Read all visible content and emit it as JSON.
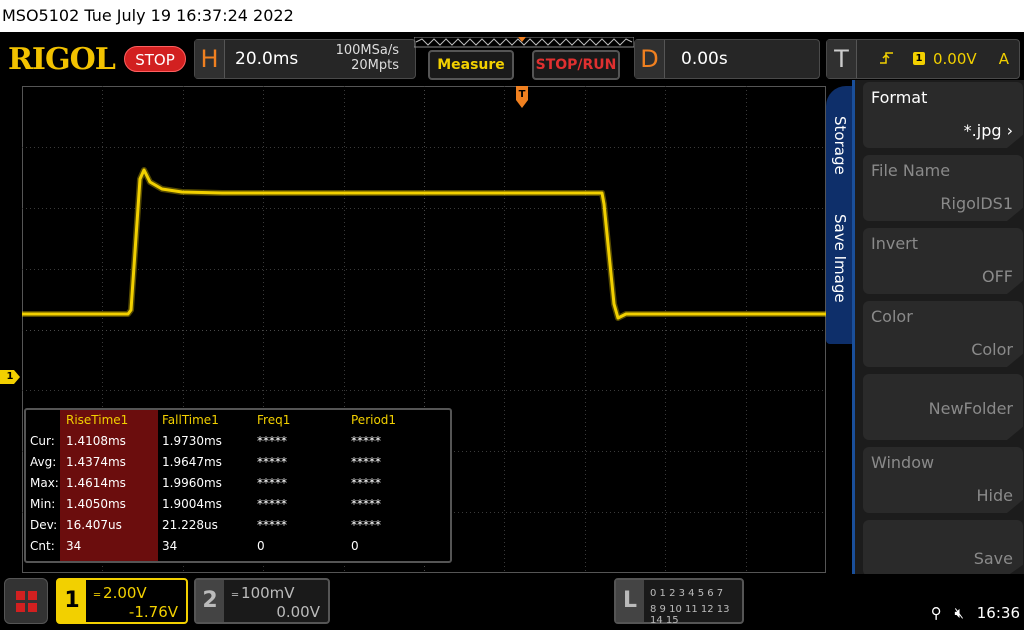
{
  "titlebar": {
    "text": "MSO5102  Tue July 19 16:37:24 2022"
  },
  "header": {
    "logo": "RIGOL",
    "run_state": "STOP",
    "horizontal": {
      "letter": "H",
      "timebase": "20.0ms",
      "sample_rate": "100MSa/s",
      "memory_depth": "20Mpts"
    },
    "measure_label": "Measure",
    "stoprun_label": "STOP/RUN",
    "delay": {
      "letter": "D",
      "value": "0.00s"
    },
    "trigger": {
      "letter": "T",
      "source": "1",
      "level": "0.00V",
      "mode": "A"
    }
  },
  "measurements": {
    "row_labels": [
      "Cur:",
      "Avg:",
      "Max:",
      "Min:",
      "Dev:",
      "Cnt:"
    ],
    "columns": [
      {
        "name": "RiseTime1",
        "values": [
          "1.4108ms",
          "1.4374ms",
          "1.4614ms",
          "1.4050ms",
          "16.407us",
          "34"
        ]
      },
      {
        "name": "FallTime1",
        "values": [
          "1.9730ms",
          "1.9647ms",
          "1.9960ms",
          "1.9004ms",
          "21.228us",
          "34"
        ]
      },
      {
        "name": "Freq1",
        "values": [
          "*****",
          "*****",
          "*****",
          "*****",
          "*****",
          "0"
        ]
      },
      {
        "name": "Period1",
        "values": [
          "*****",
          "*****",
          "*****",
          "*****",
          "*****",
          "0"
        ]
      }
    ]
  },
  "menu": {
    "tab_storage": "Storage",
    "tab_save_image": "Save Image",
    "items": [
      {
        "label": "Format",
        "value": "*.jpg"
      },
      {
        "label": "File Name",
        "value": "RigolDS1"
      },
      {
        "label": "Invert",
        "value": "OFF"
      },
      {
        "label": "Color",
        "value": "Color"
      },
      {
        "label": "",
        "value": "NewFolder"
      },
      {
        "label": "Window",
        "value": "Hide"
      },
      {
        "label": "",
        "value": "Save"
      }
    ]
  },
  "channels": {
    "ch1": {
      "num": "1",
      "scale": "2.00V",
      "offset": "-1.76V",
      "marker": "1"
    },
    "ch2": {
      "num": "2",
      "scale": "100mV",
      "offset": "0.00V"
    }
  },
  "logic": {
    "letter": "L",
    "row1": "0 1 2 3  4 5 6 7",
    "row2": "8 9 10 11 12 13 14 15"
  },
  "status": {
    "time": "16:36"
  },
  "colors": {
    "ch1": "#f2d000",
    "accent": "#f08020",
    "menu_tab": "#0e2f6a"
  }
}
